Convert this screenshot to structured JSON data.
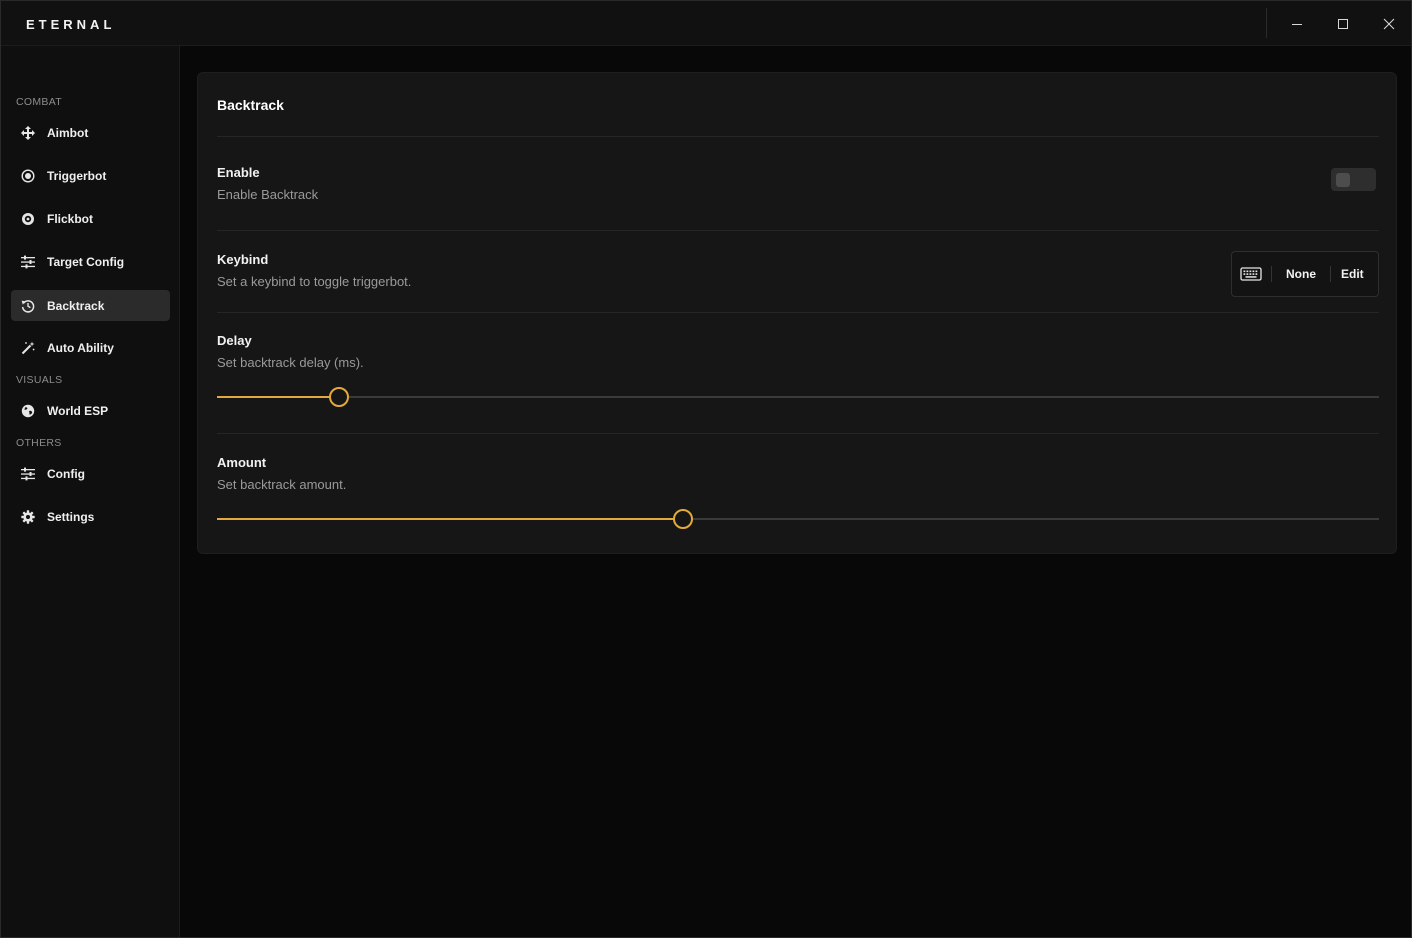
{
  "window": {
    "title": "ETERNAL",
    "controls": {
      "minimize": "minimize-icon",
      "maximize": "maximize-icon",
      "close": "close-icon"
    }
  },
  "sidebar": {
    "sections": [
      {
        "label": "COMBAT",
        "items": [
          {
            "label": "Aimbot",
            "icon": "move-arrows-icon"
          },
          {
            "label": "Triggerbot",
            "icon": "target-icon"
          },
          {
            "label": "Flickbot",
            "icon": "compass-icon"
          },
          {
            "label": "Target Config",
            "icon": "sliders-icon"
          },
          {
            "label": "Backtrack",
            "icon": "history-icon",
            "active": true
          },
          {
            "label": "Auto Ability",
            "icon": "magic-wand-icon"
          }
        ]
      },
      {
        "label": "VISUALS",
        "items": [
          {
            "label": "World ESP",
            "icon": "globe-icon"
          }
        ]
      },
      {
        "label": "OTHERS",
        "items": [
          {
            "label": "Config",
            "icon": "sliders-icon"
          },
          {
            "label": "Settings",
            "icon": "gear-icon"
          }
        ]
      }
    ]
  },
  "panel": {
    "title": "Backtrack",
    "enable": {
      "title": "Enable",
      "description": "Enable Backtrack",
      "value": false
    },
    "keybind": {
      "title": "Keybind",
      "description": "Set a keybind to toggle triggerbot.",
      "value": "None",
      "edit_label": "Edit",
      "icon": "keyboard-icon"
    },
    "delay": {
      "title": "Delay",
      "description": "Set backtrack delay (ms).",
      "fraction": 0.105
    },
    "amount": {
      "title": "Amount",
      "description": "Set backtrack amount.",
      "fraction": 0.401
    }
  },
  "colors": {
    "accent": "#e3a93a",
    "background": "#080808",
    "panel": "#161616",
    "sidebar": "#0f0f0f",
    "active_item": "#2b2b2b"
  }
}
